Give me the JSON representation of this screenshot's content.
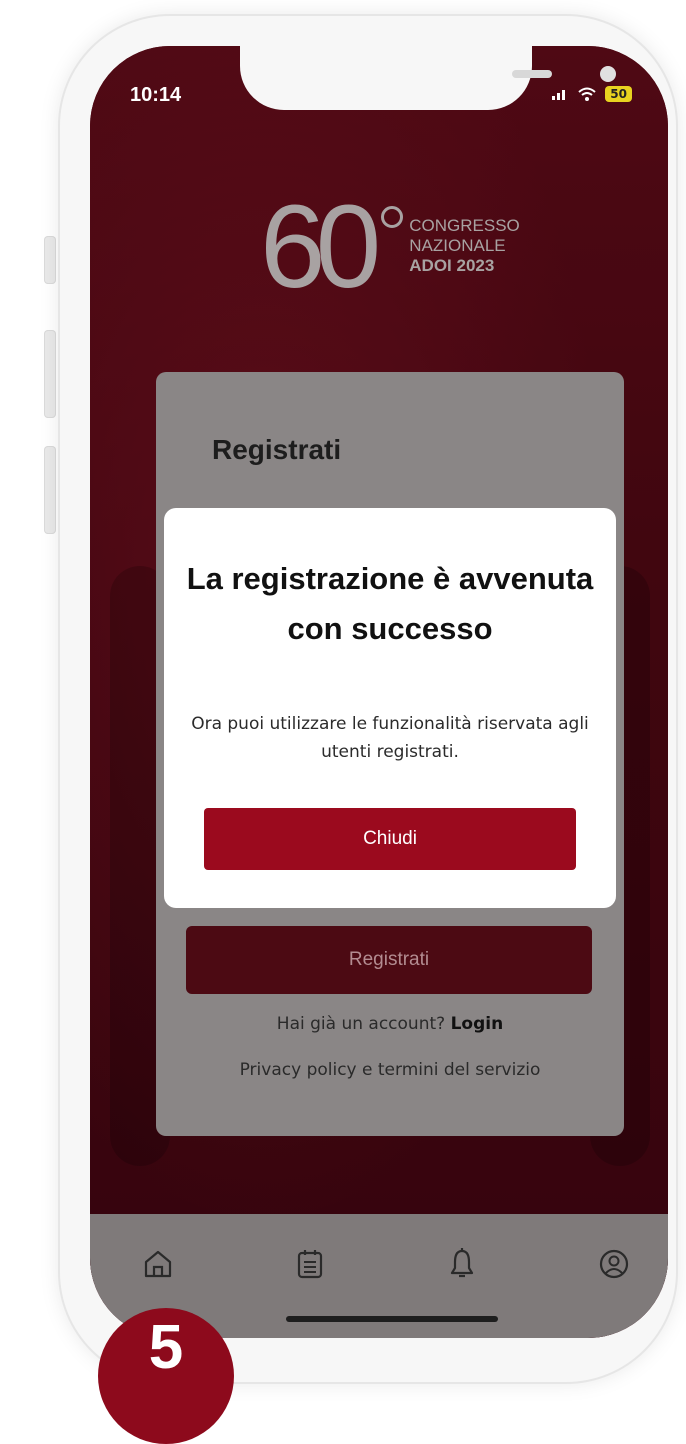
{
  "status_bar": {
    "time": "10:14",
    "battery": "50"
  },
  "logo": {
    "number": "60",
    "lines": [
      "CONGRESSO",
      "NAZIONALE",
      "ADOI 2023"
    ]
  },
  "card": {
    "title": "Registrati",
    "register_button": "Registrati",
    "account_prompt": "Hai già un account?",
    "login_link": "Login",
    "privacy_link": "Privacy policy e termini del servizio"
  },
  "modal": {
    "title": "La registrazione è avvenuta con successo",
    "text": "Ora puoi utilizzare le funzionalità riservata agli utenti registrati.",
    "close_button": "Chiudi"
  },
  "nav": {
    "items": [
      "home-icon",
      "calendar-icon",
      "bell-icon",
      "user-icon"
    ]
  },
  "step_badge": "5",
  "colors": {
    "brand": "#9b0a1e",
    "background": "#4a0712",
    "nav": "#7f7a7a"
  }
}
